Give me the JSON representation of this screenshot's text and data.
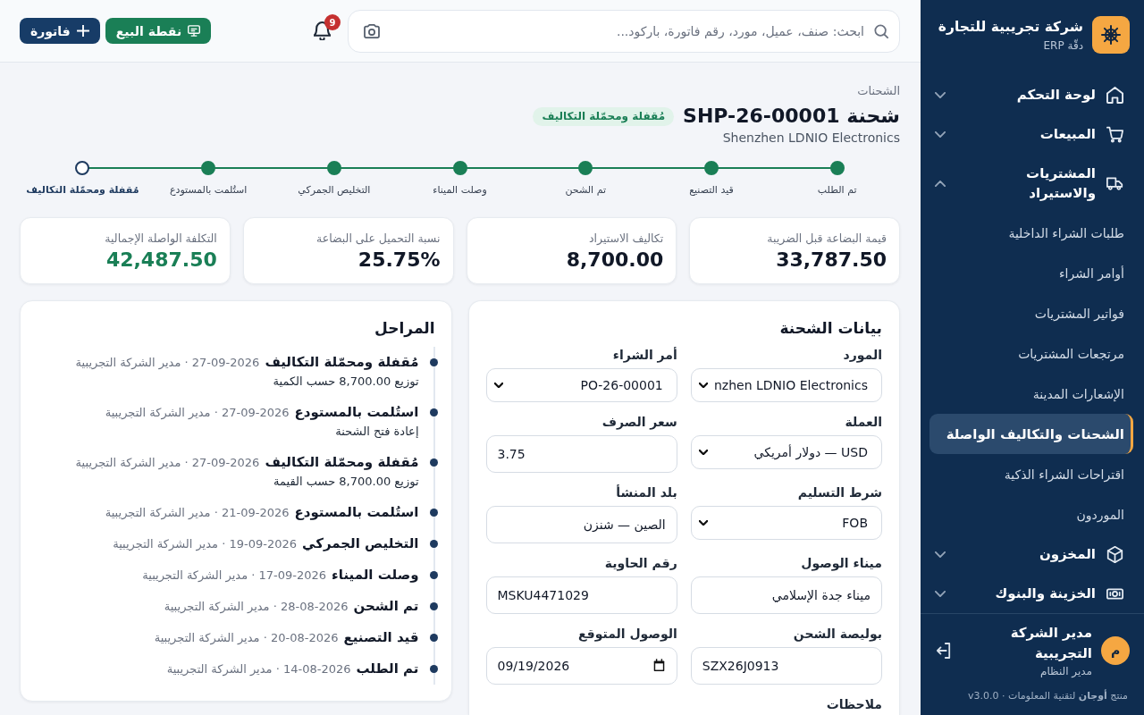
{
  "sidebar": {
    "brand": {
      "name": "شركة تجريبية للتجارة",
      "tagline": "دقّة ERP"
    },
    "nav": [
      {
        "label": "لوحة التحكم",
        "expanded": false
      },
      {
        "label": "المبيعات",
        "expanded": false
      },
      {
        "label": "المشتريات والاستيراد",
        "expanded": true,
        "children": [
          {
            "label": "طلبات الشراء الداخلية",
            "selected": false
          },
          {
            "label": "أوامر الشراء",
            "selected": false
          },
          {
            "label": "فواتير المشتريات",
            "selected": false
          },
          {
            "label": "مرتجعات المشتريات",
            "selected": false
          },
          {
            "label": "الإشعارات المدينة",
            "selected": false
          },
          {
            "label": "الشحنات والتكاليف الواصلة",
            "selected": true
          },
          {
            "label": "اقتراحات الشراء الذكية",
            "selected": false
          },
          {
            "label": "الموردون",
            "selected": false
          }
        ]
      },
      {
        "label": "المخزون",
        "expanded": false
      },
      {
        "label": "الخزينة والبنوك",
        "expanded": false
      }
    ],
    "user": {
      "initial": "م",
      "name": "مدير الشركة التجريبية",
      "role": "مدير النظام"
    },
    "footer_note": "منتج **أوجان** لتقنية المعلومات · v3.0.0"
  },
  "top_bar": {
    "search": {
      "placeholder": "ابحث: صنف، عميل، مورد، رقم فاتورة، باركود..."
    },
    "notifications": {
      "count": "9"
    },
    "buttons": [
      {
        "label": "نقطة البيع",
        "kind": "pos"
      },
      {
        "label": "فاتورة",
        "kind": "new"
      }
    ]
  },
  "header": {
    "breadcrumb": "الشحنات",
    "title": "شحنة SHP-26-00001",
    "status": "مُقفلة ومحمّلة التكاليف",
    "supplier": "Shenzhen LDNIO Electronics"
  },
  "stepper": [
    {
      "label": "تم الطلب",
      "done": true,
      "current": false
    },
    {
      "label": "قيد التصنيع",
      "done": true,
      "current": false
    },
    {
      "label": "تم الشحن",
      "done": true,
      "current": false
    },
    {
      "label": "وصلت الميناء",
      "done": true,
      "current": false
    },
    {
      "label": "التخليص الجمركي",
      "done": true,
      "current": false
    },
    {
      "label": "استُلمت بالمستودع",
      "done": true,
      "current": false
    },
    {
      "label": "مُقفلة ومحمّلة التكاليف",
      "done": false,
      "current": true
    }
  ],
  "stats": [
    {
      "label": "قيمة البضاعة قبل الضريبة",
      "value": "33,787.50",
      "highlight": false
    },
    {
      "label": "تكاليف الاستيراد",
      "value": "8,700.00",
      "highlight": false
    },
    {
      "label": "نسبة التحميل على البضاعة",
      "value": "25.75%",
      "highlight": false
    },
    {
      "label": "التكلفة الواصلة الإجمالية",
      "value": "42,487.50",
      "highlight": true
    }
  ],
  "shipment_form": {
    "title": "بيانات الشحنة",
    "fields": [
      {
        "label": "المورد",
        "kind": "select",
        "value": "nzhen LDNIO Electronics"
      },
      {
        "label": "أمر الشراء",
        "kind": "select",
        "value": "PO-26-00001"
      },
      {
        "label": "العملة",
        "kind": "select",
        "value": "USD — دولار أمريكي"
      },
      {
        "label": "سعر الصرف",
        "kind": "text",
        "value": "3.75"
      },
      {
        "label": "شرط التسليم",
        "kind": "select",
        "value": "FOB"
      },
      {
        "label": "بلد المنشأ",
        "kind": "text",
        "value": "الصين — شنزن"
      },
      {
        "label": "ميناء الوصول",
        "kind": "text",
        "value": "ميناء جدة الإسلامي"
      },
      {
        "label": "رقم الحاوية",
        "kind": "text",
        "value": "MSKU4471029"
      },
      {
        "label": "بوليصة الشحن",
        "kind": "text",
        "value": "SZX26J0913"
      },
      {
        "label": "الوصول المتوقع",
        "kind": "date",
        "value": "09/19/2026"
      }
    ],
    "notes_label": "ملاحظات"
  },
  "stages": {
    "title": "المراحل",
    "events": [
      {
        "title": "مُقفلة ومحمّلة التكاليف",
        "meta": "27-09-2026 · مدير الشركة التجريبية",
        "note": "توزيع 8,700.00 حسب الكمية"
      },
      {
        "title": "استُلمت بالمستودع",
        "meta": "27-09-2026 · مدير الشركة التجريبية",
        "note": "إعادة فتح الشحنة"
      },
      {
        "title": "مُقفلة ومحمّلة التكاليف",
        "meta": "27-09-2026 · مدير الشركة التجريبية",
        "note": "توزيع 8,700.00 حسب القيمة"
      },
      {
        "title": "استُلمت بالمستودع",
        "meta": "21-09-2026 · مدير الشركة التجريبية"
      },
      {
        "title": "التخليص الجمركي",
        "meta": "19-09-2026 · مدير الشركة التجريبية"
      },
      {
        "title": "وصلت الميناء",
        "meta": "17-09-2026 · مدير الشركة التجريبية"
      },
      {
        "title": "تم الشحن",
        "meta": "28-08-2026 · مدير الشركة التجريبية"
      },
      {
        "title": "قيد التصنيع",
        "meta": "20-08-2026 · مدير الشركة التجريبية"
      },
      {
        "title": "تم الطلب",
        "meta": "14-08-2026 · مدير الشركة التجريبية"
      }
    ]
  }
}
